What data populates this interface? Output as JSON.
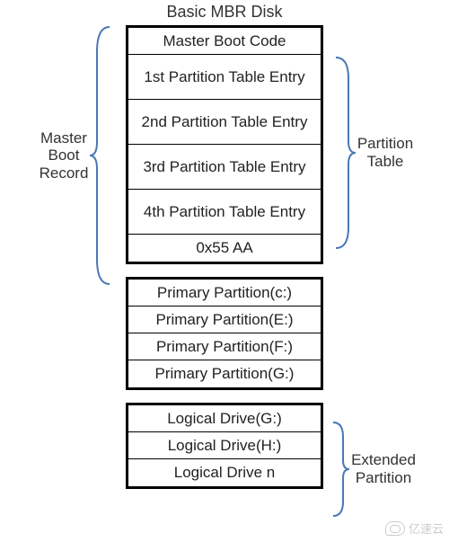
{
  "title": "Basic MBR Disk",
  "mbr_group": {
    "rows": [
      "Master Boot Code",
      "1st Partition Table Entry",
      "2nd Partition Table Entry",
      "3rd Partition Table Entry",
      "4th Partition Table Entry",
      "0x55 AA"
    ]
  },
  "primary_group": {
    "rows": [
      "Primary Partition(c:)",
      "Primary Partition(E:)",
      "Primary Partition(F:)",
      "Primary Partition(G:)"
    ]
  },
  "extended_group": {
    "rows": [
      "Logical Drive(G:)",
      "Logical Drive(H:)",
      "Logical Drive n"
    ]
  },
  "labels": {
    "mbr": "Master\nBoot\nRecord",
    "partition_table": "Partition\nTable",
    "extended_partition": "Extended\nPartition"
  },
  "colors": {
    "bracket": "#4a78b5"
  },
  "watermark": "亿速云"
}
